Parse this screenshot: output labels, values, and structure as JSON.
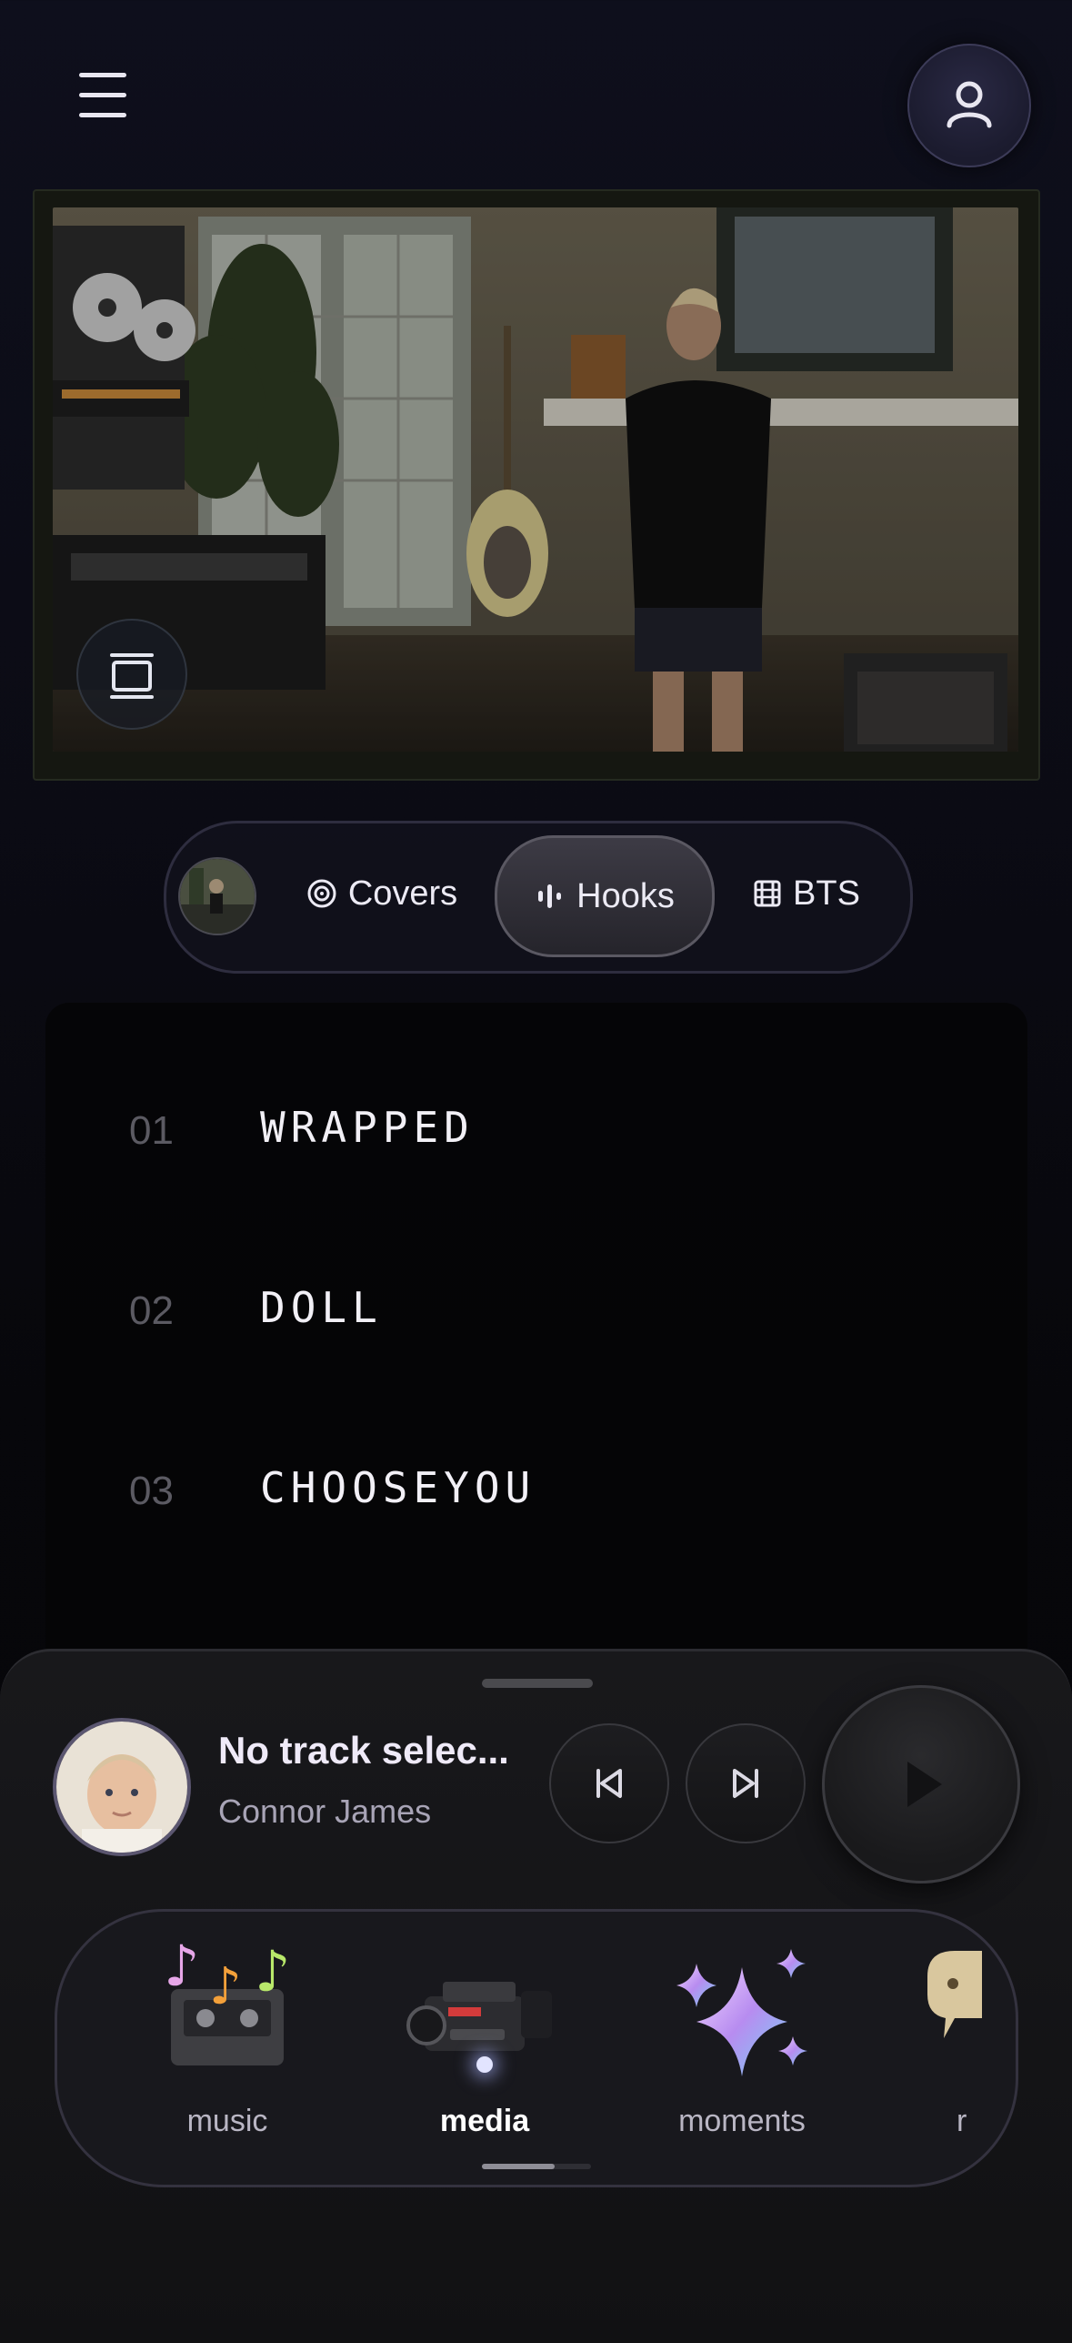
{
  "tabs": {
    "items": [
      {
        "label": "Covers",
        "icon": "disc-icon"
      },
      {
        "label": "Hooks",
        "icon": "waveform-icon",
        "active": true
      },
      {
        "label": "BTS",
        "icon": "film-icon"
      }
    ]
  },
  "tracks": [
    {
      "number": "01",
      "title": "WRAPPED"
    },
    {
      "number": "02",
      "title": "DOLL"
    },
    {
      "number": "03",
      "title": "CHOOSEYOU"
    }
  ],
  "player": {
    "title": "No track selec...",
    "artist": "Connor James"
  },
  "nav": {
    "items": [
      {
        "label": "music",
        "icon": "cassette-music-icon"
      },
      {
        "label": "media",
        "icon": "camcorder-icon",
        "active": true
      },
      {
        "label": "moments",
        "icon": "sparkles-icon"
      },
      {
        "label": "r",
        "icon": "speech-bubble-icon"
      }
    ]
  },
  "colors": {
    "background": "#0b0b14",
    "accent_dot": "#e2e4ff",
    "text_primary": "#efeaf8",
    "text_secondary": "#a8a4b6",
    "track_number": "#5b5a62"
  }
}
